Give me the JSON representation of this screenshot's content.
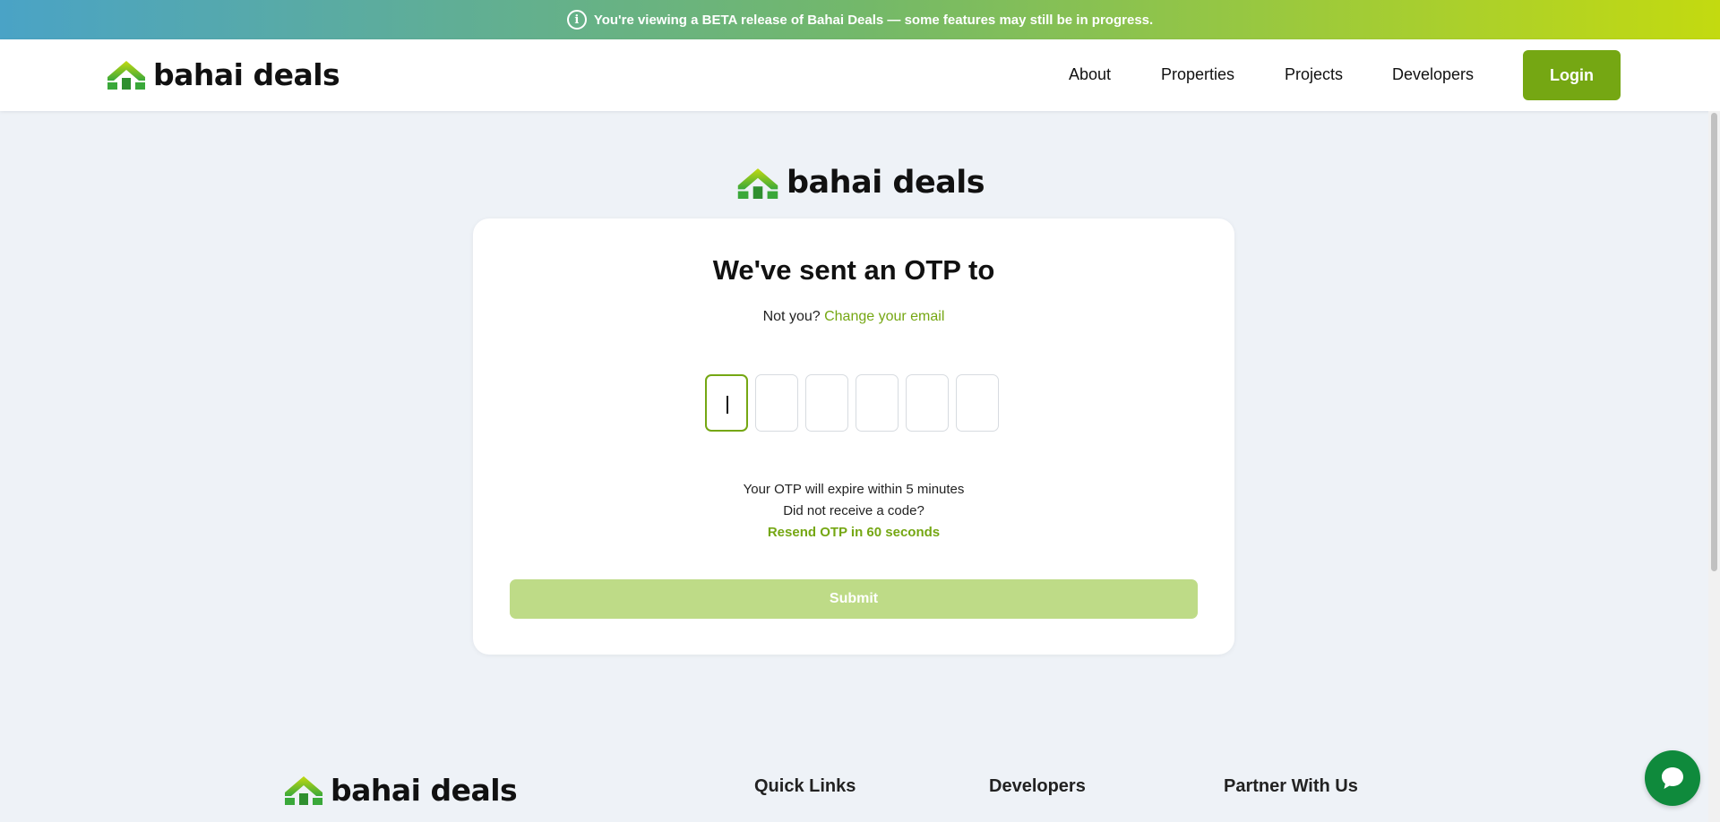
{
  "beta_banner": {
    "icon": "info-icon",
    "text": "You're viewing a BETA release of Bahai Deals — some features may still be in progress."
  },
  "brand": {
    "name": "bahai deals",
    "accent_color": "#75a713",
    "logo_icon": "house-logo-icon"
  },
  "nav": {
    "links": [
      "About",
      "Properties",
      "Projects",
      "Developers"
    ],
    "login_label": "Login"
  },
  "otp_card": {
    "title": "We've sent an OTP to",
    "not_you_prefix": "Not you?",
    "change_email_label": "Change your email",
    "otp_digits": [
      "",
      "",
      "",
      "",
      "",
      ""
    ],
    "expire_text": "Your OTP will expire within 5 minutes",
    "not_received_text": "Did not receive a code?",
    "resend_text": "Resend OTP in 60 seconds",
    "submit_label": "Submit"
  },
  "footer": {
    "headings": [
      "Quick Links",
      "Developers",
      "Partner With Us"
    ]
  },
  "chat": {
    "icon": "chat-bubble-icon"
  }
}
